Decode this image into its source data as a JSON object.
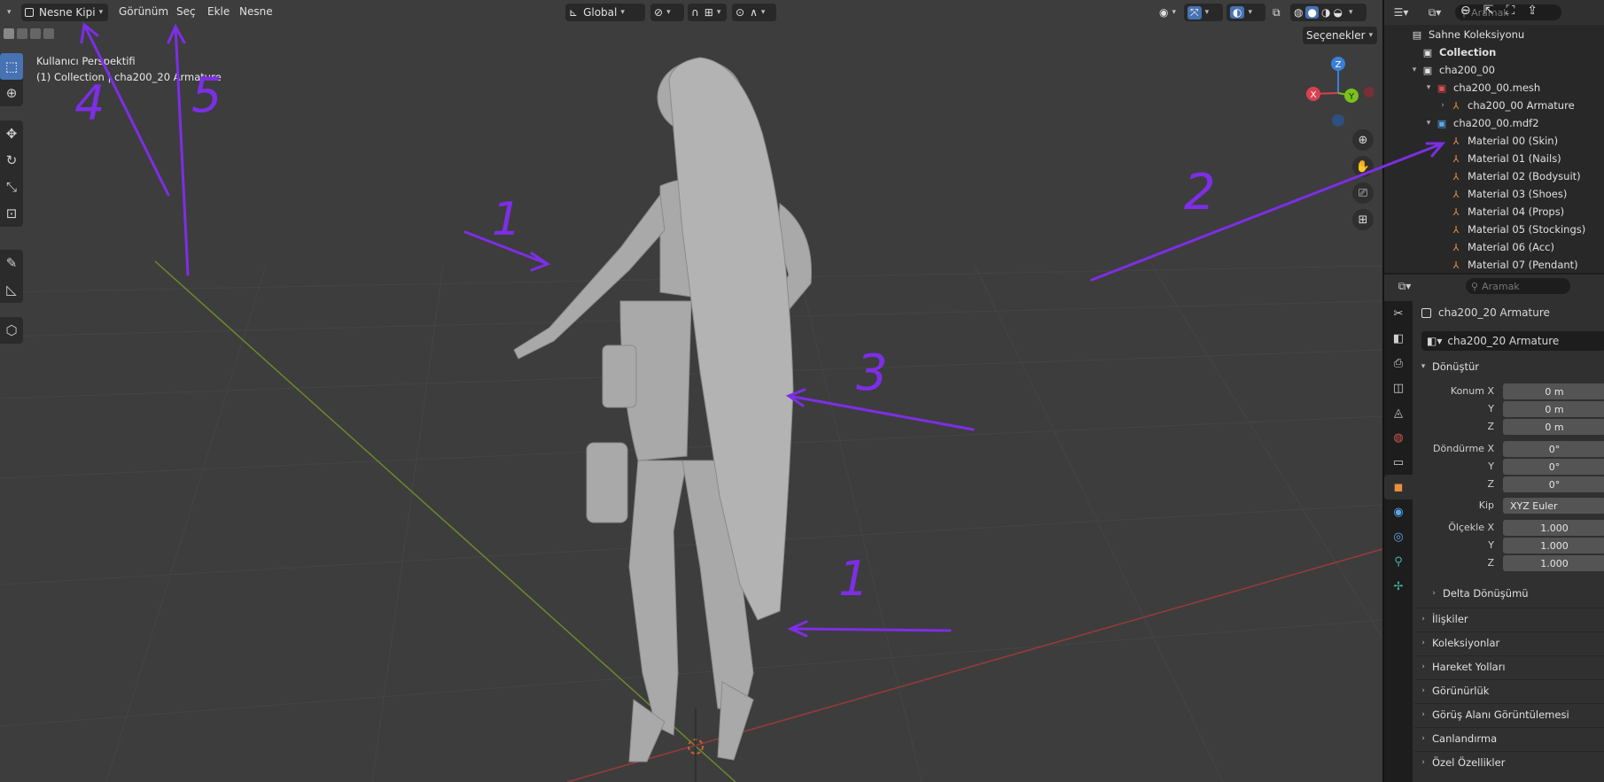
{
  "viewport": {
    "mode_label": "Nesne Kipi",
    "menus": [
      "Görünüm",
      "Seç",
      "Ekle",
      "Nesne"
    ],
    "orientation": "Global",
    "options_button": "Seçenekler",
    "perspective_label": "Kullanıcı Perspektifi",
    "collection_label": "(1) Collection | cha200_20 Armature",
    "gizmo_axes": [
      "Z",
      "X",
      "Y"
    ],
    "annotations": [
      "1",
      "2",
      "3",
      "4",
      "5",
      "1"
    ]
  },
  "outliner": {
    "search_placeholder": "Aramak",
    "scene_collection": "Sahne Koleksiyonu",
    "items": [
      {
        "label": "Collection",
        "icon": "collection-icon",
        "color": "#e0e0e0"
      },
      {
        "label": "cha200_00",
        "icon": "collection-icon",
        "color": "#e0e0e0"
      },
      {
        "label": "cha200_00.mesh",
        "icon": "collection-icon",
        "color": "#e05050"
      },
      {
        "label": "cha200_00 Armature",
        "icon": "armature-icon",
        "color": "#e89040"
      },
      {
        "label": "cha200_00.mdf2",
        "icon": "collection-icon",
        "color": "#5aa8e8"
      },
      {
        "label": "Material 00 (Skin)",
        "icon": "armature-icon",
        "color": "#e89040"
      },
      {
        "label": "Material 01 (Nails)",
        "icon": "armature-icon",
        "color": "#e89040"
      },
      {
        "label": "Material 02 (Bodysuit)",
        "icon": "armature-icon",
        "color": "#e89040"
      },
      {
        "label": "Material 03 (Shoes)",
        "icon": "armature-icon",
        "color": "#e89040"
      },
      {
        "label": "Material 04 (Props)",
        "icon": "armature-icon",
        "color": "#e89040"
      },
      {
        "label": "Material 05 (Stockings)",
        "icon": "armature-icon",
        "color": "#e89040"
      },
      {
        "label": "Material 06 (Acc)",
        "icon": "armature-icon",
        "color": "#e89040"
      },
      {
        "label": "Material 07 (Pendant)",
        "icon": "armature-icon",
        "color": "#e89040"
      }
    ]
  },
  "properties": {
    "search_placeholder": "Aramak",
    "object_name": "cha200_20 Armature",
    "datablock_name": "cha200_20 Armature",
    "transform_panel": "Dönüştür",
    "location_label": "Konum X",
    "rotation_label": "Döndürme X",
    "mode_label": "Kip",
    "mode_value": "XYZ Euler",
    "scale_label": "Ölçekle X",
    "axis_y": "Y",
    "axis_z": "Z",
    "location": [
      "0 m",
      "0 m",
      "0 m"
    ],
    "rotation": [
      "0°",
      "0°",
      "0°"
    ],
    "scale": [
      "1.000",
      "1.000",
      "1.000"
    ],
    "delta_transform": "Delta Dönüşümü",
    "panels": [
      "İlişkiler",
      "Koleksiyonlar",
      "Hareket Yolları",
      "Görünürlük",
      "Görüş Alanı Görüntülemesi",
      "Canlandırma",
      "Özel Özellikler"
    ]
  },
  "colors": {
    "annotation": "#7d2ee6",
    "accent": "#4772b3",
    "x_axis": "#d8424f",
    "y_axis": "#7bc11d",
    "z_axis": "#3b7fd6"
  }
}
